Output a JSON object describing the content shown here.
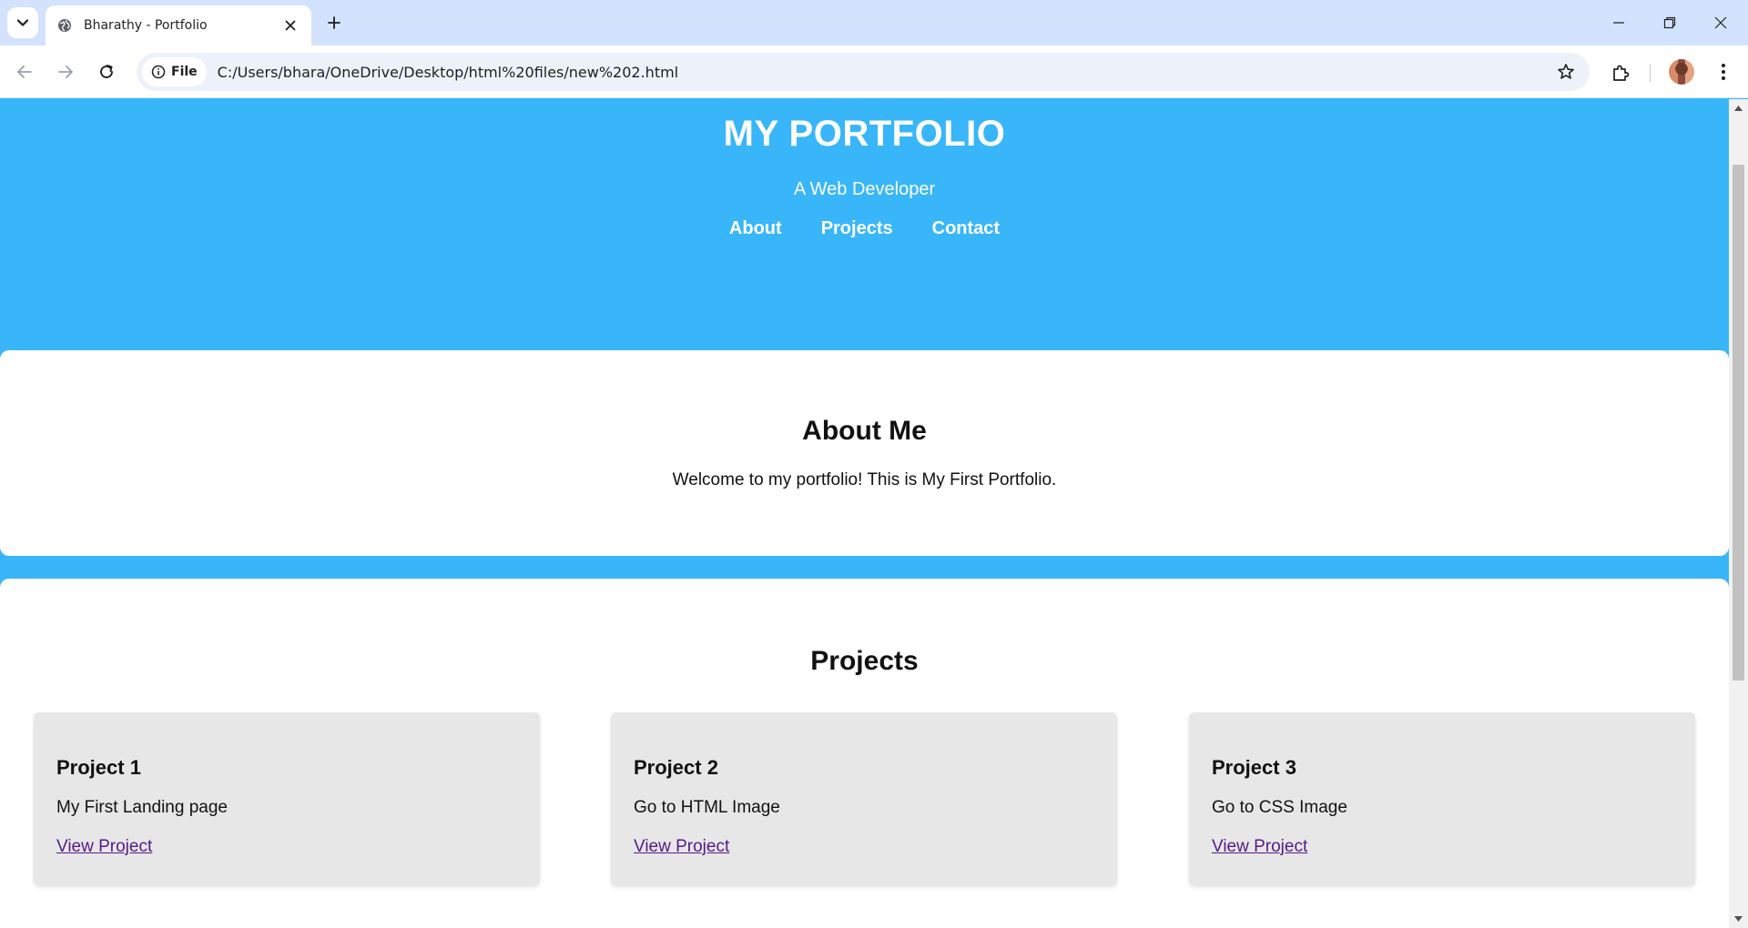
{
  "browser": {
    "tab_title": "Bharathy - Portfolio",
    "site_chip_label": "File",
    "url": "C:/Users/bhara/OneDrive/Desktop/html%20files/new%202.html"
  },
  "hero": {
    "title": "MY PORTFOLIO",
    "subtitle": "A Web Developer",
    "nav": [
      "About",
      "Projects",
      "Contact"
    ]
  },
  "about": {
    "heading": "About Me",
    "text": "Welcome to my portfolio! This is My First Portfolio."
  },
  "projects": {
    "heading": "Projects",
    "items": [
      {
        "title": "Project 1",
        "description": "My First Landing page",
        "link": "View Project"
      },
      {
        "title": "Project 2",
        "description": "Go to HTML Image",
        "link": "View Project"
      },
      {
        "title": "Project 3",
        "description": "Go to CSS Image",
        "link": "View Project"
      }
    ]
  },
  "colors": {
    "page_background": "#38b6f9",
    "card_background": "#e7e7e7",
    "link": "#551a8b",
    "tabstrip": "#d3e3fd"
  }
}
